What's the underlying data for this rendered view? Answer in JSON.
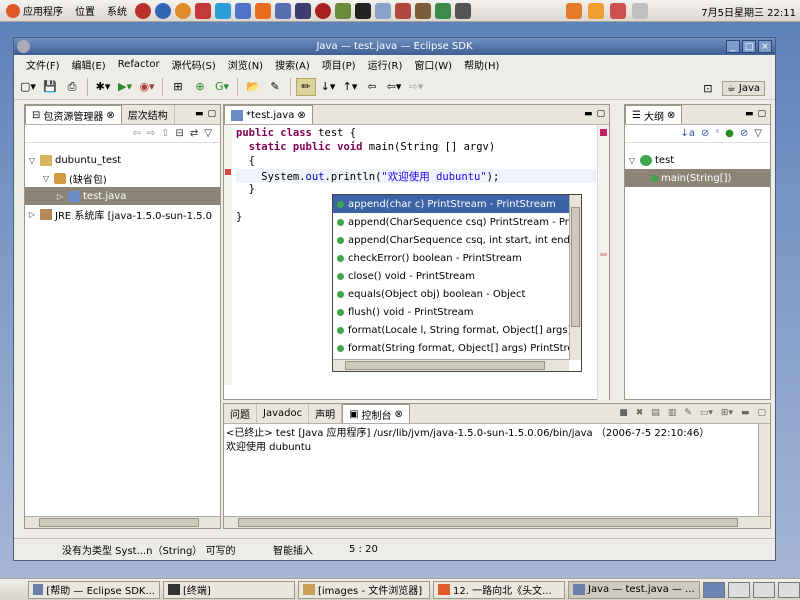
{
  "panel_top": {
    "menus": [
      "应用程序",
      "位置",
      "系统"
    ],
    "clock": "7月5日星期三 22:11"
  },
  "window": {
    "title": "Java — test.java — Eclipse SDK"
  },
  "menubar": [
    "文件(F)",
    "编辑(E)",
    "Refactor",
    "源代码(S)",
    "浏览(N)",
    "搜索(A)",
    "项目(P)",
    "运行(R)",
    "窗口(W)",
    "帮助(H)"
  ],
  "perspective": {
    "label": "Java"
  },
  "explorer": {
    "tabs": [
      "包资源管理器",
      "层次结构"
    ],
    "tree": [
      {
        "label": "dubuntu_test",
        "level": 0,
        "expanded": true
      },
      {
        "label": "(缺省包)",
        "level": 1,
        "expanded": true
      },
      {
        "label": "test.java",
        "level": 2,
        "selected": true
      },
      {
        "label": "JRE 系统库 [java-1.5.0-sun-1.5.0",
        "level": 0,
        "expanded": false
      }
    ]
  },
  "editor": {
    "tab": "*test.java",
    "lines": [
      {
        "kw": "public class",
        "rest": " test {"
      },
      {
        "kw": "  static public void",
        "rest": " main(String [] argv)"
      },
      {
        "kw": "",
        "rest": "  {"
      },
      {
        "pre": "    System.",
        "field": "out",
        "mid": ".println(",
        "str": "\"欢迎使用 dubuntu\"",
        "post": ");"
      },
      {
        "kw": "",
        "rest": "  }"
      },
      {
        "kw": "",
        "rest": ""
      },
      {
        "kw": "",
        "rest": "}"
      }
    ]
  },
  "completion": {
    "items": [
      "append(char c)  PrintStream - PrintStream",
      "append(CharSequence csq)  PrintStream - Pr",
      "append(CharSequence csq, int start, int end",
      "checkError()  boolean - PrintStream",
      "close()  void - PrintStream",
      "equals(Object obj)  boolean - Object",
      "flush()  void - PrintStream",
      "format(Locale l, String format, Object[] args)",
      "format(String format, Object[] args)  PrintStre"
    ]
  },
  "outline": {
    "tab": "大纲",
    "tree": [
      {
        "label": "test",
        "level": 0
      },
      {
        "label": "main(String[])",
        "level": 1,
        "selected": true
      }
    ]
  },
  "console": {
    "tabs": [
      "问题",
      "Javadoc",
      "声明",
      "控制台"
    ],
    "header": "<已终止> test [Java 应用程序] /usr/lib/jvm/java-1.5.0-sun-1.5.0.06/bin/java （2006-7-5 22:10:46）",
    "output": "欢迎使用 dubuntu"
  },
  "statusbar": {
    "message": "没有为类型 Syst...n（String） 可写的",
    "mode": "智能插入",
    "position": "5 : 20"
  },
  "taskbar": [
    {
      "label": "[帮助 — Eclipse SDK...",
      "active": false
    },
    {
      "label": "[终端]",
      "active": false
    },
    {
      "label": "[images - 文件浏览器]",
      "active": false
    },
    {
      "label": "12. 一路向北《头文...",
      "active": false
    },
    {
      "label": "Java — test.java — ...",
      "active": true
    }
  ]
}
